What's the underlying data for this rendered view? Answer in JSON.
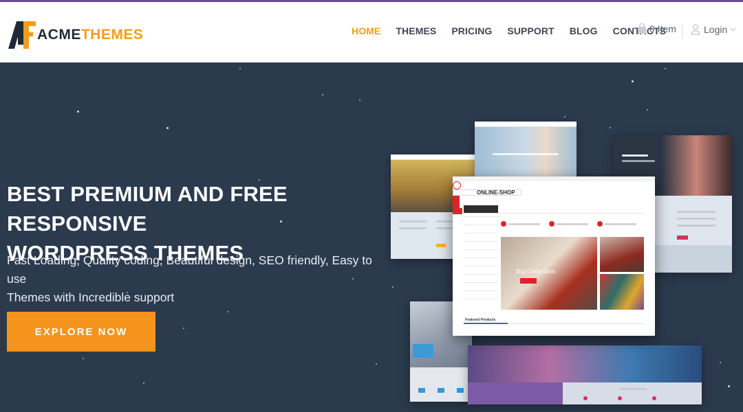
{
  "brand": {
    "name_part1": "ACME",
    "name_part2": "THEMES",
    "accent_color": "#f39c1f",
    "dark_color": "#1e2a38"
  },
  "nav": {
    "items": [
      {
        "label": "HOME",
        "active": true
      },
      {
        "label": "THEMES",
        "active": false
      },
      {
        "label": "PRICING",
        "active": false
      },
      {
        "label": "SUPPORT",
        "active": false
      },
      {
        "label": "BLOG",
        "active": false
      },
      {
        "label": "CONTACTS",
        "active": false
      }
    ]
  },
  "cart": {
    "label": "0 Item",
    "icon": "shopping-bag-icon"
  },
  "login": {
    "label": "Login",
    "icon": "user-icon"
  },
  "hero": {
    "title_line1": "BEST PREMIUM AND FREE RESPONSIVE",
    "title_line2": "WORDPRESS THEMES",
    "subtitle_line1": "Fast Loading, Quality coding, Beautiful design, SEO friendly, Easy to use",
    "subtitle_line2": "Themes with Incredible support",
    "cta_label": "EXPLORE NOW",
    "background_color": "#2c3a4e",
    "cta_color": "#f5941d"
  },
  "mockups": {
    "main_brand": "ONLINE-SHOP",
    "main_banner_text": "Big Collection",
    "main_section_title": "Featured Products"
  }
}
